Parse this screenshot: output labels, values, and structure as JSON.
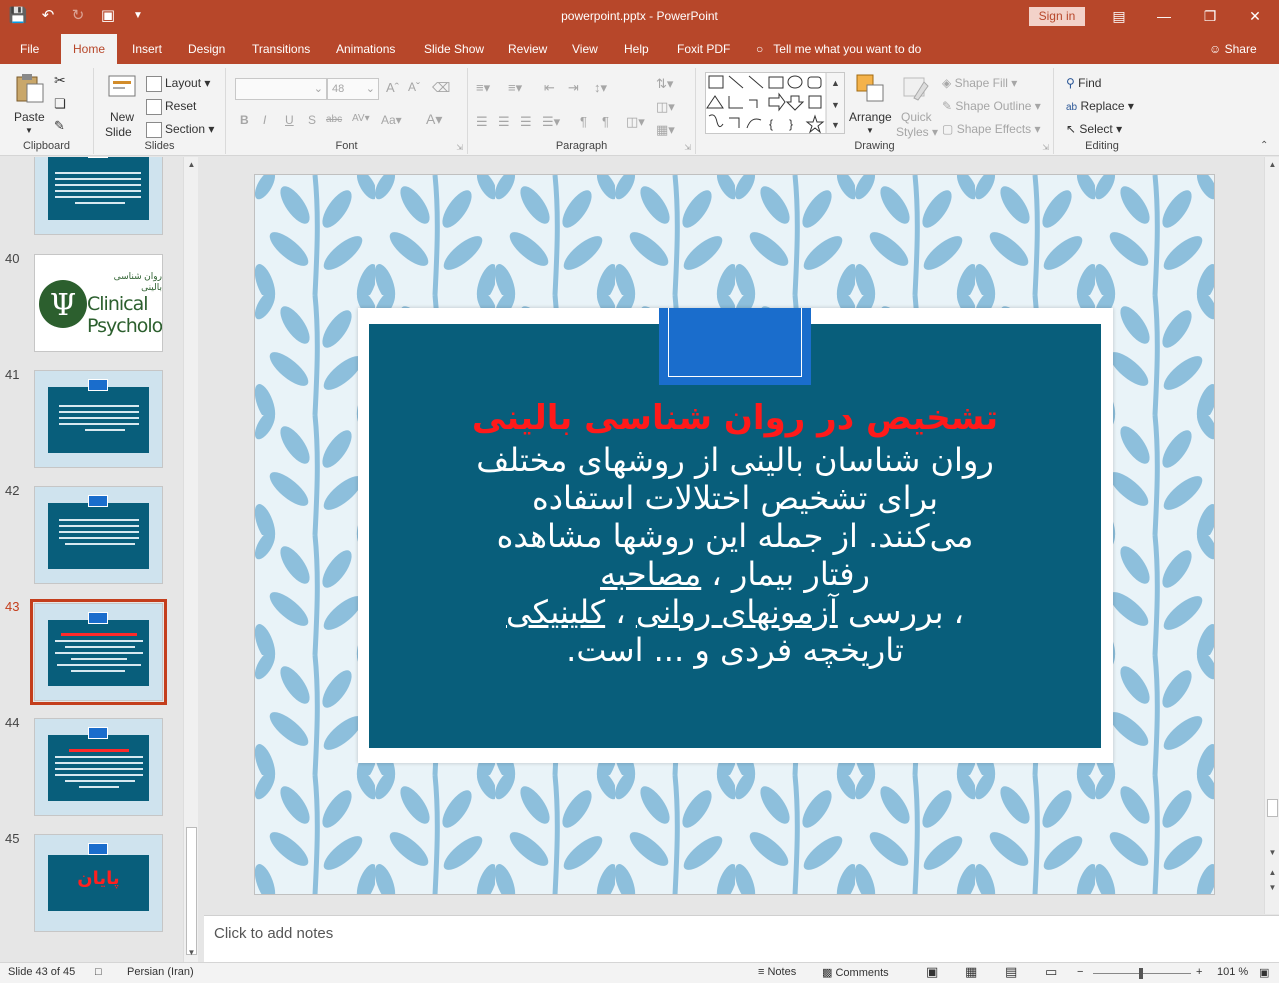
{
  "window": {
    "doc_title": "powerpoint.pptx  -  PowerPoint",
    "signin": "Sign in",
    "qat_icons": [
      "save-icon",
      "undo-icon",
      "redo-icon",
      "start-from-beginning-icon",
      "customize-icon"
    ]
  },
  "tabs": [
    {
      "label": "File"
    },
    {
      "label": "Home"
    },
    {
      "label": "Insert"
    },
    {
      "label": "Design"
    },
    {
      "label": "Transitions"
    },
    {
      "label": "Animations"
    },
    {
      "label": "Slide Show"
    },
    {
      "label": "Review"
    },
    {
      "label": "View"
    },
    {
      "label": "Help"
    },
    {
      "label": "Foxit PDF"
    }
  ],
  "tellme": "Tell me what you want to do",
  "share": "Share",
  "ribbon": {
    "clipboard": {
      "label": "Clipboard",
      "paste": "Paste"
    },
    "slides": {
      "label": "Slides",
      "new_slide": "New",
      "new_slide2": "Slide",
      "layout": "Layout",
      "reset": "Reset",
      "section": "Section"
    },
    "font": {
      "label": "Font",
      "size": "48"
    },
    "paragraph": {
      "label": "Paragraph"
    },
    "drawing": {
      "label": "Drawing",
      "arrange": "Arrange",
      "quick_styles": "Quick",
      "quick_styles2": "Styles",
      "shape_fill": "Shape Fill",
      "shape_outline": "Shape Outline",
      "shape_effects": "Shape Effects"
    },
    "editing": {
      "label": "Editing",
      "find": "Find",
      "replace": "Replace",
      "select": "Select"
    }
  },
  "thumbnails": [
    {
      "number": "40"
    },
    {
      "number": "41"
    },
    {
      "number": "42"
    },
    {
      "number": "43"
    },
    {
      "number": "44"
    },
    {
      "number": "45"
    }
  ],
  "thumb40": {
    "line1": "روان شناسی بالینی",
    "line2": "Clinical",
    "line3": "Psychology"
  },
  "thumb45": {
    "text": "پایان"
  },
  "slide": {
    "title": "تشخیص در روان شناسی بالینی",
    "body_line1": "روان شناسان بالینی از روشهای مختلف",
    "body_line2": "برای تشخیص اختلالات استفاده",
    "body_line3": "می‌کنند. از جمله این روشها مشاهده",
    "body_line4a": "رفتار بیمار ، ",
    "body_line4b": " مصاحبه",
    "body_line5a": "، بررسی ",
    "body_line5b": " آزمونهای روانی",
    "body_line5c": " ، ",
    "body_line5d": "کلینیکی",
    "body_line6": "تاریخچه فردی و ... است."
  },
  "notes": {
    "placeholder": "Click to add notes"
  },
  "status": {
    "slide_counter": "Slide 43 of 45",
    "language": "Persian (Iran)",
    "notes": "Notes",
    "comments": "Comments",
    "zoom": "101 %"
  },
  "colors": {
    "accent": "#b7472a",
    "card": "#085e7b",
    "title": "#ff1a1a",
    "pattern": "#8dbfdc"
  }
}
